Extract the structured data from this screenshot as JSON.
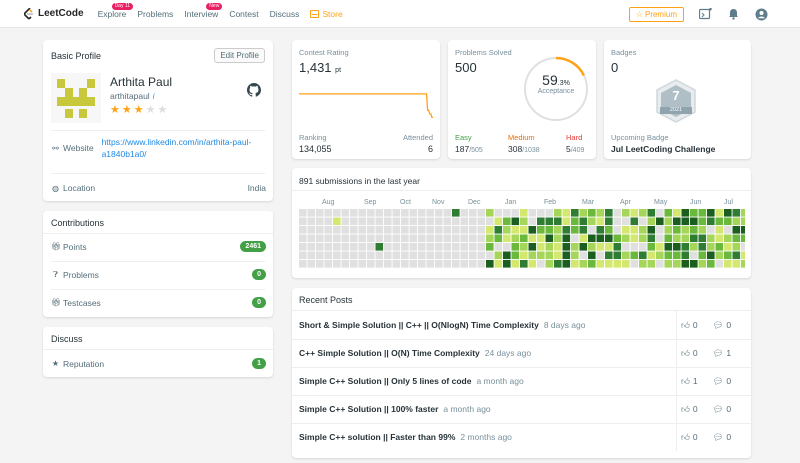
{
  "nav": {
    "logo_text": "LeetCode",
    "links": [
      {
        "label": "Explore",
        "badge": "Day 11"
      },
      {
        "label": "Problems",
        "badge": ""
      },
      {
        "label": "Interview",
        "badge": "New"
      },
      {
        "label": "Contest",
        "badge": ""
      },
      {
        "label": "Discuss",
        "badge": ""
      }
    ],
    "store_label": "Store",
    "premium_label": "Premium",
    "icons": [
      "playground-icon",
      "bell-icon",
      "user-icon"
    ]
  },
  "profile": {
    "section_title": "Basic Profile",
    "edit_label": "Edit Profile",
    "name": "Arthita Paul",
    "username": "arthitapaul",
    "info_glyph": "i",
    "rating_stars": 3,
    "max_stars": 5,
    "website_label": "Website",
    "website_url": "https://www.linkedin.com/in/arthita-paul-a1840b1a0/",
    "location_label": "Location",
    "location_value": "India"
  },
  "contributions": {
    "title": "Contributions",
    "rows": [
      {
        "label": "Points",
        "value": "2461"
      },
      {
        "label": "Problems",
        "value": "0"
      },
      {
        "label": "Testcases",
        "value": "0"
      }
    ]
  },
  "discuss": {
    "title": "Discuss",
    "rows": [
      {
        "label": "Reputation",
        "value": "1"
      }
    ]
  },
  "contest": {
    "label": "Contest Rating",
    "value": "1,431",
    "unit": "pt",
    "ranking_label": "Ranking",
    "ranking_value": "134,055",
    "attended_label": "Attended",
    "attended_value": "6",
    "trend": [
      1431,
      1431,
      1431,
      1431,
      1431,
      1431,
      1431,
      1431,
      1431,
      1431,
      1431,
      1431,
      1431,
      1431,
      1431,
      1431,
      1431,
      1431,
      1431,
      1431,
      1431,
      1431,
      1431,
      1431,
      1431,
      1431,
      1431,
      1431,
      1431,
      1431,
      1431,
      1431,
      1431,
      1431,
      1431,
      1431,
      1431,
      1431,
      1431,
      1431,
      1431,
      1431,
      1431,
      1431,
      1431,
      1431,
      1431,
      1431,
      1431,
      1431,
      1431,
      1431,
      1431,
      1431,
      1431,
      1431,
      1431,
      1431,
      1431,
      1431,
      1431,
      1431,
      1431,
      1431,
      1431,
      1431,
      1431,
      1431,
      1431,
      1431,
      1431,
      1431,
      1431,
      1431,
      1431,
      1431,
      1431,
      1431,
      1431,
      1431,
      1431,
      1431,
      1431,
      1431,
      1431,
      1431,
      1431,
      1431,
      1431,
      1431,
      1431,
      1431,
      1431,
      1431,
      1431,
      1431,
      1431,
      1431,
      1431,
      1431,
      1431,
      1431,
      1431,
      1431,
      1431,
      1431,
      1431,
      1431,
      1431,
      1431,
      1431,
      1431,
      1431,
      1431,
      1431,
      1431,
      1431,
      1431,
      1431,
      1431,
      1200,
      1200,
      1150,
      1150,
      1100,
      1100
    ],
    "trend_ylim": [
      1050,
      1500
    ]
  },
  "solved": {
    "label": "Problems Solved",
    "total": "500",
    "acceptance_value": "59",
    "acceptance_fraction": ".3%",
    "acceptance_label": "Acceptance",
    "acceptance_pct": 59.3,
    "easy_label": "Easy",
    "easy_value": "187",
    "easy_total": "/505",
    "medium_label": "Medium",
    "medium_value": "308",
    "medium_total": "/1038",
    "hard_label": "Hard",
    "hard_value": "5",
    "hard_total": "/409",
    "colors": {
      "easy": "#43a047",
      "medium": "#ef6c00",
      "hard": "#e53935",
      "ring": "#ffa116"
    }
  },
  "badges": {
    "label": "Badges",
    "count": "0",
    "badge_number": "7",
    "badge_year": "2021",
    "upcoming_label": "Upcoming Badge",
    "upcoming_name": "Jul LeetCoding Challenge"
  },
  "heatmap": {
    "title": "891 submissions in the last year",
    "months": [
      "Aug",
      "Sep",
      "Oct",
      "Nov",
      "Dec",
      "Jan",
      "Feb",
      "Mar",
      "Apr",
      "May",
      "Jun",
      "Jul"
    ],
    "colors": [
      "#e0e0e0",
      "#d4e86f",
      "#a5d65a",
      "#6bb93c",
      "#2e7d32",
      "#1b5e20"
    ]
  },
  "posts": {
    "title": "Recent Posts",
    "items": [
      {
        "title": "Short & Simple Solution || C++ || O(NlogN) Time Complexity",
        "time": "8 days ago",
        "likes": "0",
        "comments": "0"
      },
      {
        "title": "C++ Simple Solution || O(N) Time Complexity",
        "time": "24 days ago",
        "likes": "0",
        "comments": "1"
      },
      {
        "title": "Simple C++ Solution || Only 5 lines of code",
        "time": "a month ago",
        "likes": "1",
        "comments": "0"
      },
      {
        "title": "Simple C++ Solution || 100% faster",
        "time": "a month ago",
        "likes": "0",
        "comments": "0"
      },
      {
        "title": "Simple C++ solution || Faster than 99%",
        "time": "2 months ago",
        "likes": "0",
        "comments": "0"
      }
    ]
  }
}
